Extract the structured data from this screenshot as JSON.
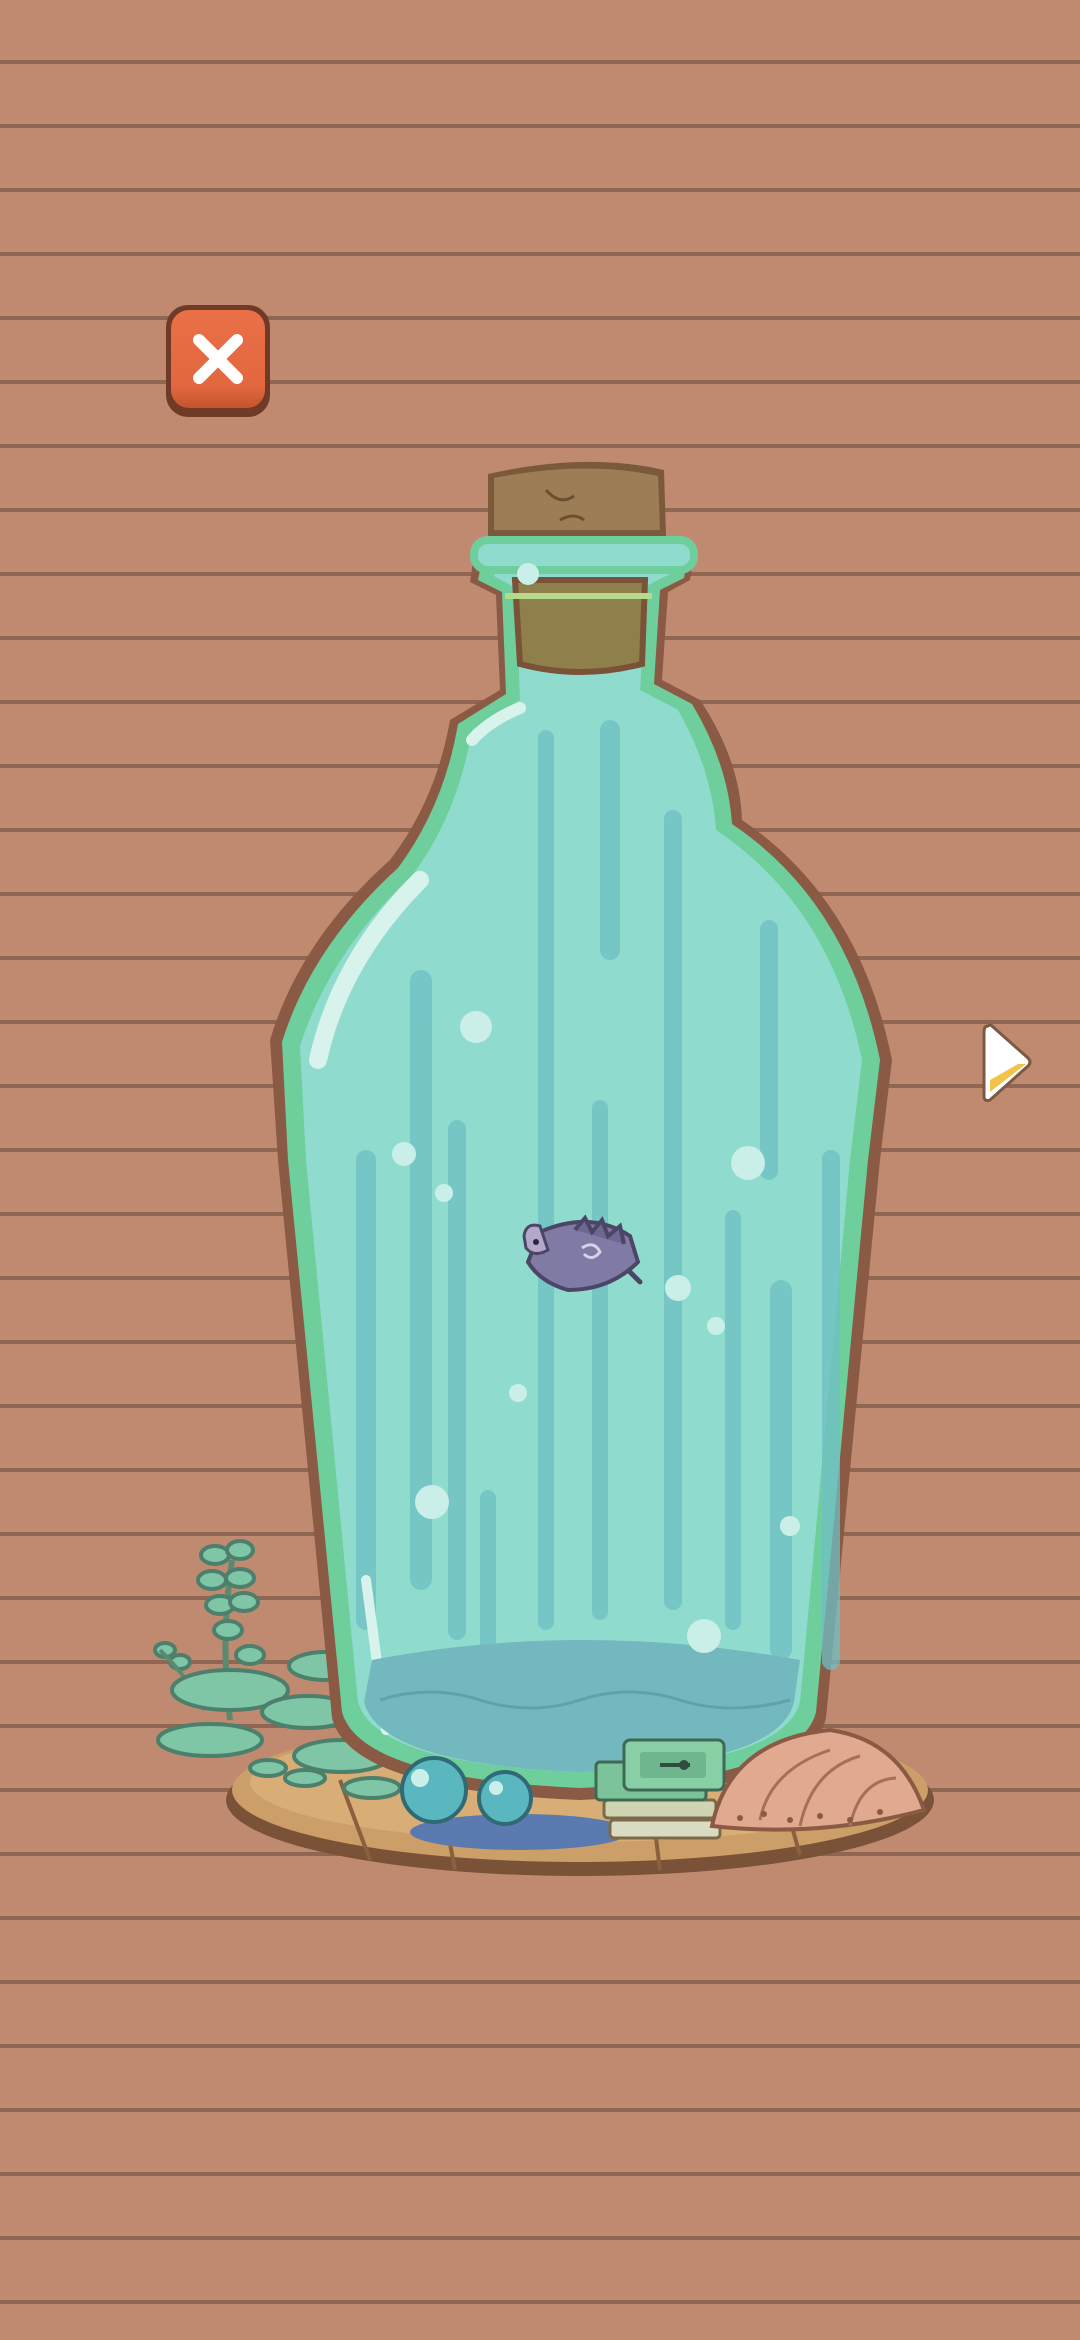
{
  "screen": {
    "name": "bottle-terrarium-view",
    "background_color": "#c08a70",
    "stripe_color": "#8f6651"
  },
  "controls": {
    "close_icon": "close-icon",
    "close_color": "#e2673e",
    "next_icon": "play-arrow-icon",
    "next_color": "#f3c24a"
  },
  "scene": {
    "bottle": {
      "glass_color": "#8fdccf",
      "rim_color": "#6fcf9c",
      "water_color": "#7fbfc5"
    },
    "cork": {
      "color": "#8f7f4a"
    },
    "creature": "sea-slug",
    "decorations": [
      "seaweed-plant",
      "glass-marbles",
      "stacked-books",
      "seashell"
    ]
  }
}
